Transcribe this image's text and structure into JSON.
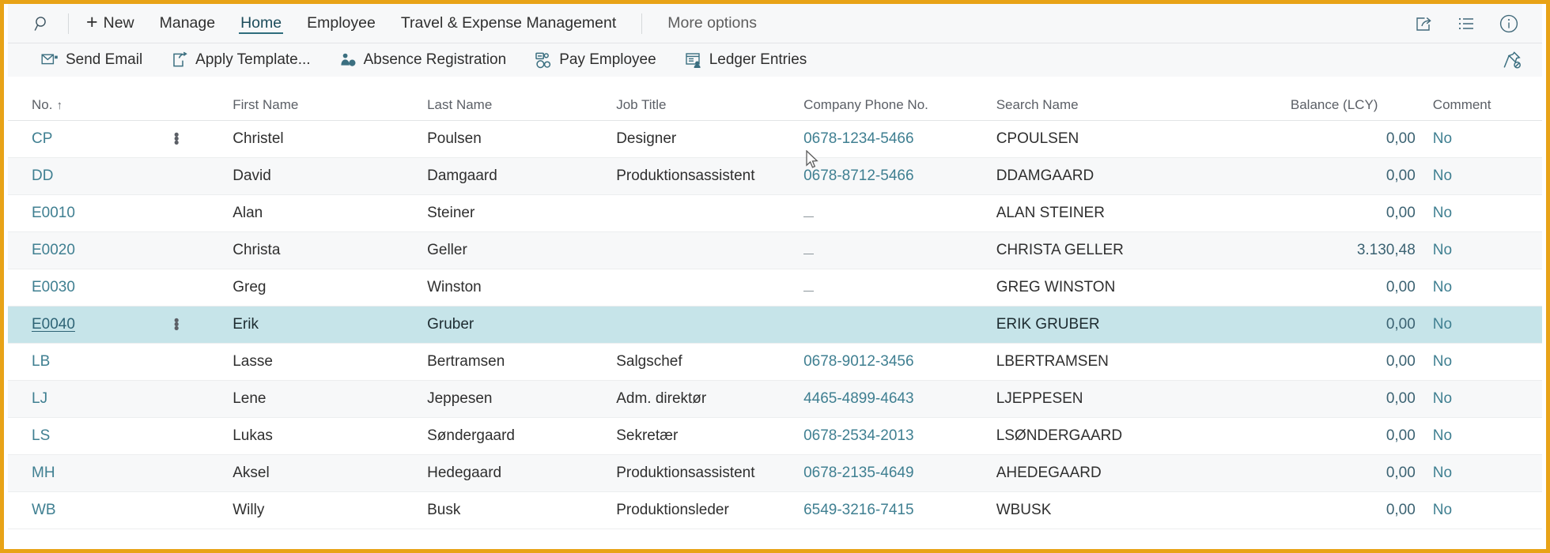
{
  "window": {
    "border_color": "#e8a317",
    "accent_color": "#2e6d7d"
  },
  "topbar": {
    "search_icon": "search-icon",
    "new_label": "New",
    "new_plus": "+",
    "items": [
      {
        "label": "Manage",
        "state": "normal"
      },
      {
        "label": "Home",
        "state": "active"
      },
      {
        "label": "Employee",
        "state": "normal"
      },
      {
        "label": "Travel & Expense Management",
        "state": "normal"
      }
    ],
    "more_options_label": "More options",
    "right_icons": [
      {
        "name": "share-icon"
      },
      {
        "name": "list-view-icon"
      },
      {
        "name": "info-icon"
      }
    ]
  },
  "actionbar": {
    "actions": [
      {
        "label": "Send Email",
        "icon": "email-icon"
      },
      {
        "label": "Apply Template...",
        "icon": "apply-template-icon"
      },
      {
        "label": "Absence Registration",
        "icon": "absence-registration-icon"
      },
      {
        "label": "Pay Employee",
        "icon": "pay-employee-icon"
      },
      {
        "label": "Ledger Entries",
        "icon": "ledger-entries-icon"
      }
    ],
    "pin_icon": "unpin-icon"
  },
  "table": {
    "sort_indicator": "↑",
    "columns": [
      {
        "key": "no",
        "label": "No.",
        "sorted": true
      },
      {
        "key": "first_name",
        "label": "First Name"
      },
      {
        "key": "last_name",
        "label": "Last Name"
      },
      {
        "key": "job_title",
        "label": "Job Title"
      },
      {
        "key": "company_phone",
        "label": "Company Phone No."
      },
      {
        "key": "search_name",
        "label": "Search Name"
      },
      {
        "key": "balance",
        "label": "Balance (LCY)"
      },
      {
        "key": "comment",
        "label": "Comment"
      }
    ],
    "rows": [
      {
        "no": "CP",
        "first_name": "Christel",
        "last_name": "Poulsen",
        "job_title": "Designer",
        "company_phone": "0678-1234-5466",
        "search_name": "CPOULSEN",
        "balance": "0,00",
        "comment": "No",
        "selected": false,
        "show_dots": true,
        "no_underline": false,
        "phone_empty": false
      },
      {
        "no": "DD",
        "first_name": "David",
        "last_name": "Damgaard",
        "job_title": "Produktionsassistent",
        "company_phone": "0678-8712-5466",
        "search_name": "DDAMGAARD",
        "balance": "0,00",
        "comment": "No",
        "selected": false,
        "show_dots": false,
        "no_underline": false,
        "phone_empty": false
      },
      {
        "no": "E0010",
        "first_name": "Alan",
        "last_name": "Steiner",
        "job_title": "",
        "company_phone": "",
        "search_name": "ALAN STEINER",
        "balance": "0,00",
        "comment": "No",
        "selected": false,
        "show_dots": false,
        "no_underline": false,
        "phone_empty": true
      },
      {
        "no": "E0020",
        "first_name": "Christa",
        "last_name": "Geller",
        "job_title": "",
        "company_phone": "",
        "search_name": "CHRISTA GELLER",
        "balance": "3.130,48",
        "comment": "No",
        "selected": false,
        "show_dots": false,
        "no_underline": false,
        "phone_empty": true
      },
      {
        "no": "E0030",
        "first_name": "Greg",
        "last_name": " Winston",
        "job_title": "",
        "company_phone": "",
        "search_name": "GREG  WINSTON",
        "balance": "0,00",
        "comment": "No",
        "selected": false,
        "show_dots": false,
        "no_underline": false,
        "phone_empty": true
      },
      {
        "no": "E0040",
        "first_name": "Erik",
        "last_name": "Gruber",
        "job_title": "",
        "company_phone": "",
        "search_name": "ERIK GRUBER",
        "balance": "0,00",
        "comment": "No",
        "selected": true,
        "show_dots": true,
        "no_underline": true,
        "phone_empty": false
      },
      {
        "no": "LB",
        "first_name": "Lasse",
        "last_name": "Bertramsen",
        "job_title": "Salgschef",
        "company_phone": "0678-9012-3456",
        "search_name": "LBERTRAMSEN",
        "balance": "0,00",
        "comment": "No",
        "selected": false,
        "show_dots": false,
        "no_underline": false,
        "phone_empty": false
      },
      {
        "no": "LJ",
        "first_name": "Lene",
        "last_name": "Jeppesen",
        "job_title": "Adm. direktør",
        "company_phone": "4465-4899-4643",
        "search_name": "LJEPPESEN",
        "balance": "0,00",
        "comment": "No",
        "selected": false,
        "show_dots": false,
        "no_underline": false,
        "phone_empty": false
      },
      {
        "no": "LS",
        "first_name": "Lukas",
        "last_name": "Søndergaard",
        "job_title": "Sekretær",
        "company_phone": "0678-2534-2013",
        "search_name": "LSØNDERGAARD",
        "balance": "0,00",
        "comment": "No",
        "selected": false,
        "show_dots": false,
        "no_underline": false,
        "phone_empty": false
      },
      {
        "no": "MH",
        "first_name": "Aksel",
        "last_name": "Hedegaard",
        "job_title": "Produktionsassistent",
        "company_phone": "0678-2135-4649",
        "search_name": "AHEDEGAARD",
        "balance": "0,00",
        "comment": "No",
        "selected": false,
        "show_dots": false,
        "no_underline": false,
        "phone_empty": false
      },
      {
        "no": "WB",
        "first_name": "Willy",
        "last_name": "Busk",
        "job_title": "Produktionsleder",
        "company_phone": "6549-3216-7415",
        "search_name": "WBUSK",
        "balance": "0,00",
        "comment": "No",
        "selected": false,
        "show_dots": false,
        "no_underline": false,
        "phone_empty": false
      }
    ]
  }
}
